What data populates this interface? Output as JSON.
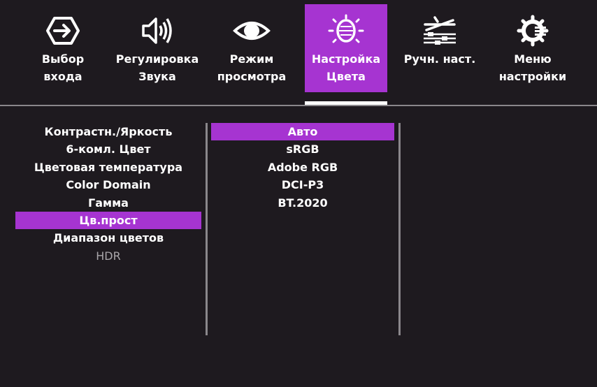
{
  "colors": {
    "accent": "#a634d1",
    "background": "#1e1a1f",
    "separator": "#8a878b",
    "disabled_text": "#a9a6aa"
  },
  "tabs": [
    {
      "icon": "input-arrow-icon",
      "label": "Выбор\nвхода"
    },
    {
      "icon": "speaker-icon",
      "label": "Регулировка\nЗвука"
    },
    {
      "icon": "eye-icon",
      "label": "Режим\nпросмотра"
    },
    {
      "icon": "color-bulb-icon",
      "label": "Настройка\nЦвета",
      "active": true
    },
    {
      "icon": "manual-adjust-icon",
      "label": "Ручн. наст."
    },
    {
      "icon": "gear-icon",
      "label": "Меню\nнастройки"
    }
  ],
  "submenu": [
    "Контрастн./Яркость",
    "6-комл. Цвет",
    "Цветовая температура",
    "Color Domain",
    "Гамма",
    "Цв.прост",
    "Диапазон цветов",
    "HDR"
  ],
  "submenu_selected": "Цв.прост",
  "submenu_disabled": "HDR",
  "options": [
    "Авто",
    "sRGB",
    "Adobe RGB",
    "DCI-P3",
    "BT.2020"
  ],
  "options_selected": "Авто"
}
